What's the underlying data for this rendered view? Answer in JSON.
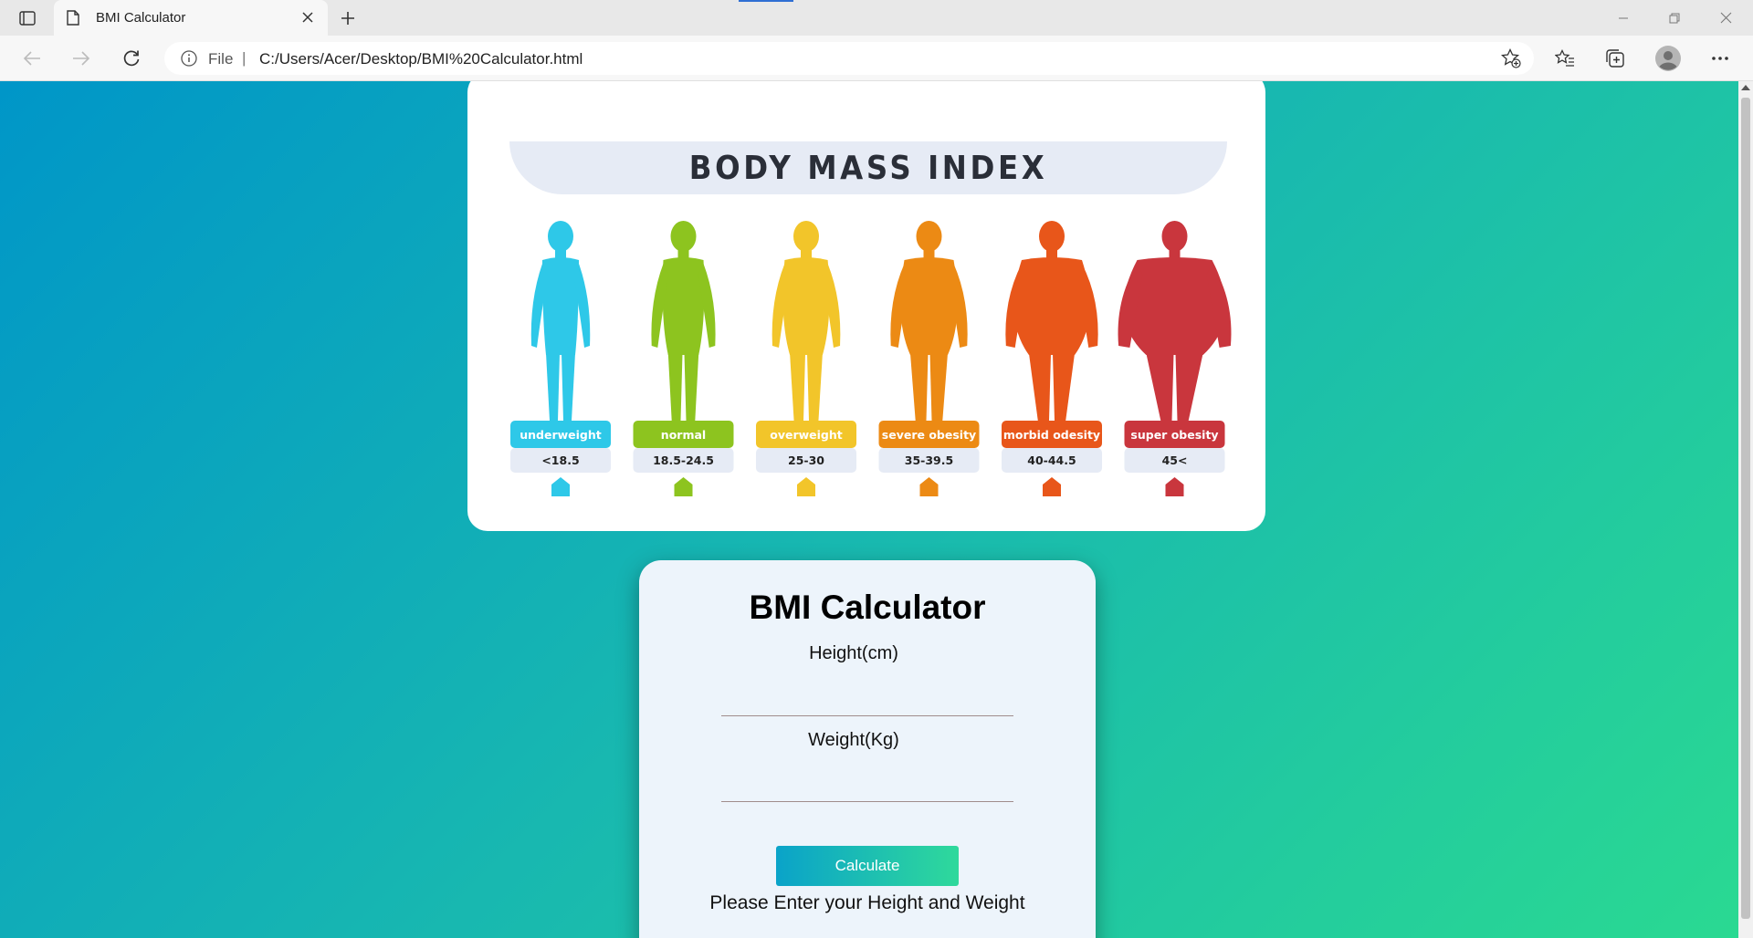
{
  "browser": {
    "tab": {
      "title": "BMI Calculator"
    },
    "address": {
      "scheme": "File",
      "separator": "|",
      "url": "C:/Users/Acer/Desktop/BMI%20Calculator.html"
    }
  },
  "bmi_chart": {
    "title": "BODY MASS INDEX",
    "categories": [
      {
        "label": "underweight",
        "range": "<18.5",
        "color": "#2ec8e8"
      },
      {
        "label": "normal",
        "range": "18.5-24.5",
        "color": "#8dc41f"
      },
      {
        "label": "overweight",
        "range": "25-30",
        "color": "#f2c52a"
      },
      {
        "label": "severe obesity",
        "range": "35-39.5",
        "color": "#ec8a14"
      },
      {
        "label": "morbid odesity",
        "range": "40-44.5",
        "color": "#e8561a"
      },
      {
        "label": "super obesity",
        "range": "45<",
        "color": "#c9363d"
      }
    ]
  },
  "calculator": {
    "title": "BMI Calculator",
    "height_label": "Height(cm)",
    "weight_label": "Weight(Kg)",
    "button_label": "Calculate",
    "result": "Please Enter your Height and Weight"
  }
}
